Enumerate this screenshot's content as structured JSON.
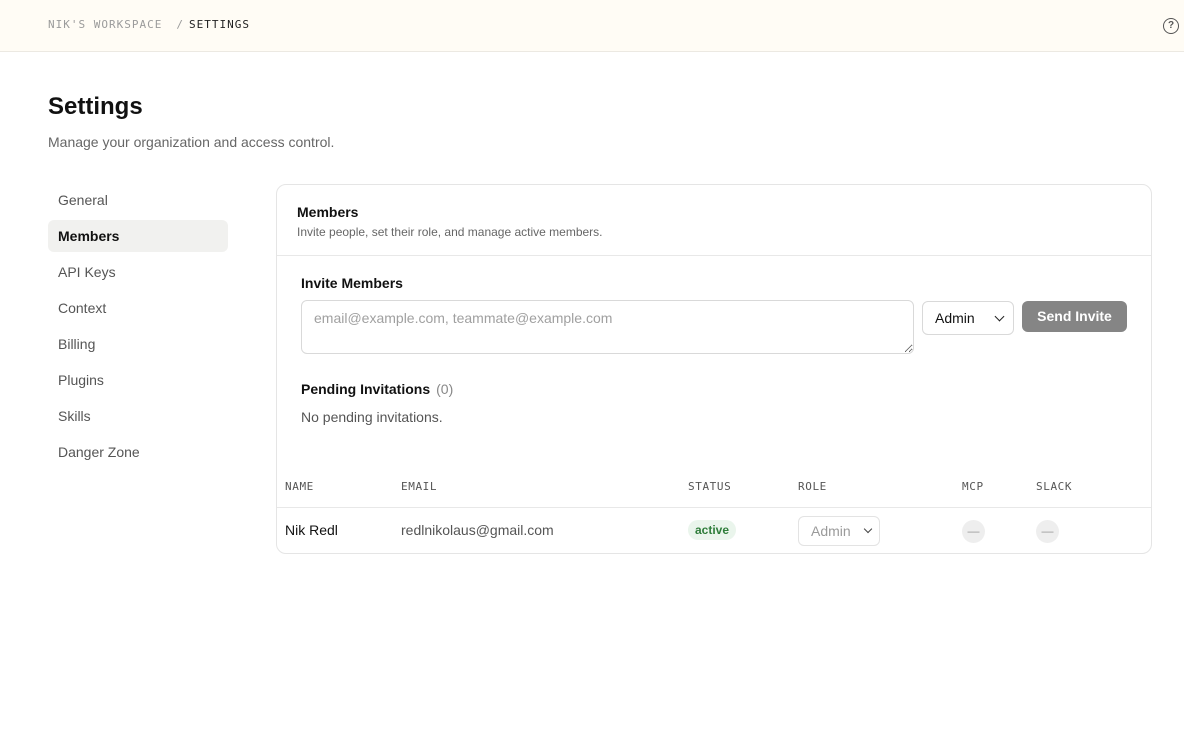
{
  "breadcrumb": {
    "workspace": "NIK'S WORKSPACE",
    "separator": "/",
    "current": "SETTINGS"
  },
  "help_icon": {
    "icon": "help-circle-icon",
    "glyph": "?"
  },
  "page": {
    "title": "Settings",
    "subtitle": "Manage your organization and access control."
  },
  "sidebar": {
    "items": [
      {
        "label": "General",
        "active": false
      },
      {
        "label": "Members",
        "active": true
      },
      {
        "label": "API Keys",
        "active": false
      },
      {
        "label": "Context",
        "active": false
      },
      {
        "label": "Billing",
        "active": false
      },
      {
        "label": "Plugins",
        "active": false
      },
      {
        "label": "Skills",
        "active": false
      },
      {
        "label": "Danger Zone",
        "active": false
      }
    ]
  },
  "members_card": {
    "title": "Members",
    "subtitle": "Invite people, set their role, and manage active members.",
    "invite": {
      "title": "Invite Members",
      "placeholder": "email@example.com, teammate@example.com",
      "role_value": "Admin",
      "send_label": "Send Invite"
    },
    "pending": {
      "title": "Pending Invitations",
      "count": "(0)",
      "empty_text": "No pending invitations."
    },
    "table": {
      "columns": [
        "NAME",
        "EMAIL",
        "STATUS",
        "ROLE",
        "MCP",
        "SLACK"
      ],
      "rows": [
        {
          "name": "Nik Redl",
          "email": "redlnikolaus@gmail.com",
          "status": "active",
          "role": "Admin",
          "mcp": "—",
          "slack": "—"
        }
      ]
    }
  },
  "colors": {
    "topbar_bg": "#fffcf5",
    "active_nav_bg": "#f1f1ef",
    "send_button_bg": "#858585",
    "status_active_bg": "#eaf5ec",
    "status_active_text": "#2e7d3a"
  }
}
